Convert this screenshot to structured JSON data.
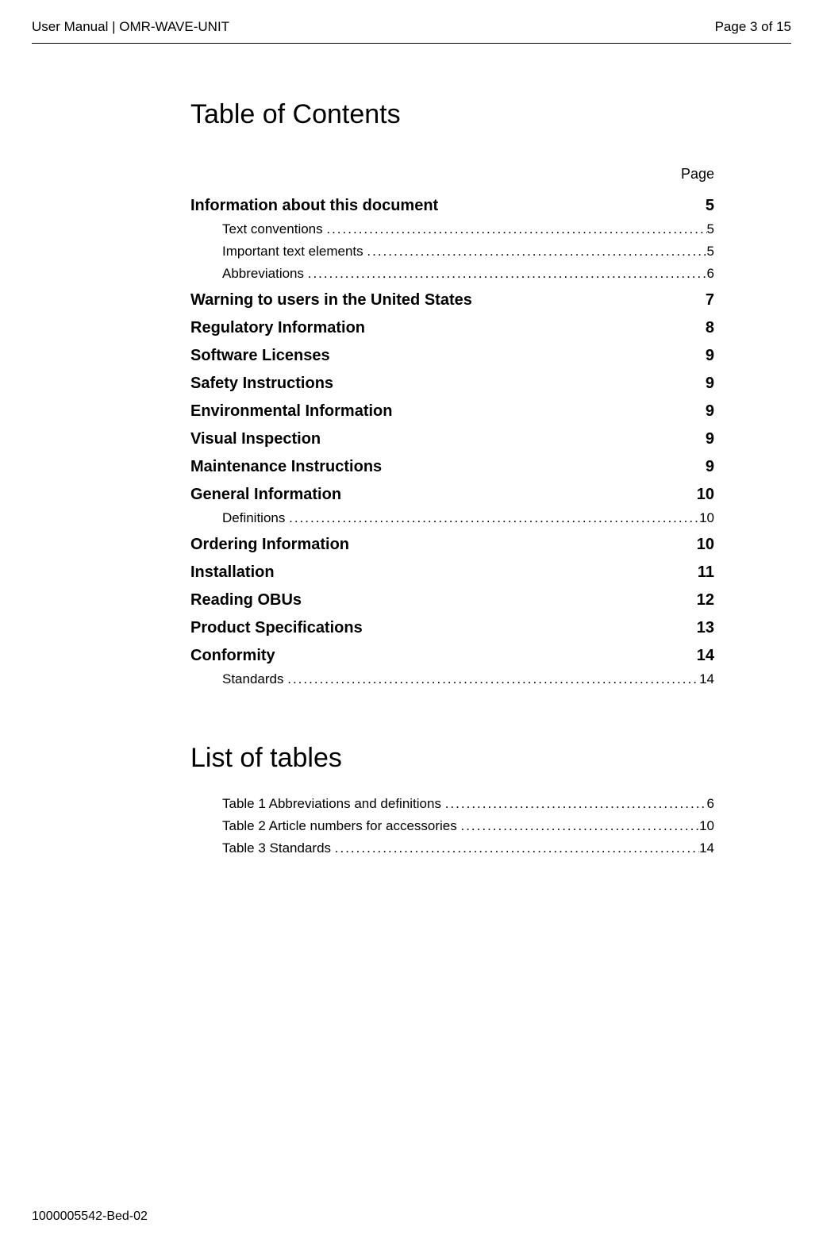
{
  "header": {
    "left": "User Manual | OMR-WAVE-UNIT",
    "right": "Page 3 of 15"
  },
  "toc": {
    "title": "Table of Contents",
    "page_label": "Page",
    "entries": [
      {
        "type": "section",
        "title": "Information about this document",
        "page": "5"
      },
      {
        "type": "sub",
        "title": "Text conventions",
        "page": "5"
      },
      {
        "type": "sub",
        "title": "Important text elements",
        "page": "5"
      },
      {
        "type": "sub",
        "title": "Abbreviations",
        "page": "6"
      },
      {
        "type": "section",
        "title": "Warning to users in the United States",
        "page": "7"
      },
      {
        "type": "section",
        "title": "Regulatory Information",
        "page": "8"
      },
      {
        "type": "section",
        "title": "Software Licenses",
        "page": "9"
      },
      {
        "type": "section",
        "title": "Safety Instructions",
        "page": "9"
      },
      {
        "type": "section",
        "title": "Environmental Information",
        "page": "9"
      },
      {
        "type": "section",
        "title": "Visual Inspection",
        "page": "9"
      },
      {
        "type": "section",
        "title": "Maintenance Instructions",
        "page": "9"
      },
      {
        "type": "section",
        "title": "General Information",
        "page": "10"
      },
      {
        "type": "sub",
        "title": "Definitions",
        "page": "10"
      },
      {
        "type": "section",
        "title": "Ordering Information",
        "page": "10"
      },
      {
        "type": "section",
        "title": "Installation",
        "page": "11"
      },
      {
        "type": "section",
        "title": "Reading OBUs",
        "page": "12"
      },
      {
        "type": "section",
        "title": "Product Specifications",
        "page": "13"
      },
      {
        "type": "section",
        "title": "Conformity",
        "page": "14"
      },
      {
        "type": "sub",
        "title": "Standards",
        "page": "14"
      }
    ]
  },
  "list_of_tables": {
    "title": "List of tables",
    "entries": [
      {
        "title": "Table 1 Abbreviations and definitions",
        "page": "6"
      },
      {
        "title": "Table 2 Article numbers for accessories",
        "page": "10"
      },
      {
        "title": "Table 3 Standards",
        "page": "14"
      }
    ]
  },
  "footer": "1000005542-Bed-02"
}
